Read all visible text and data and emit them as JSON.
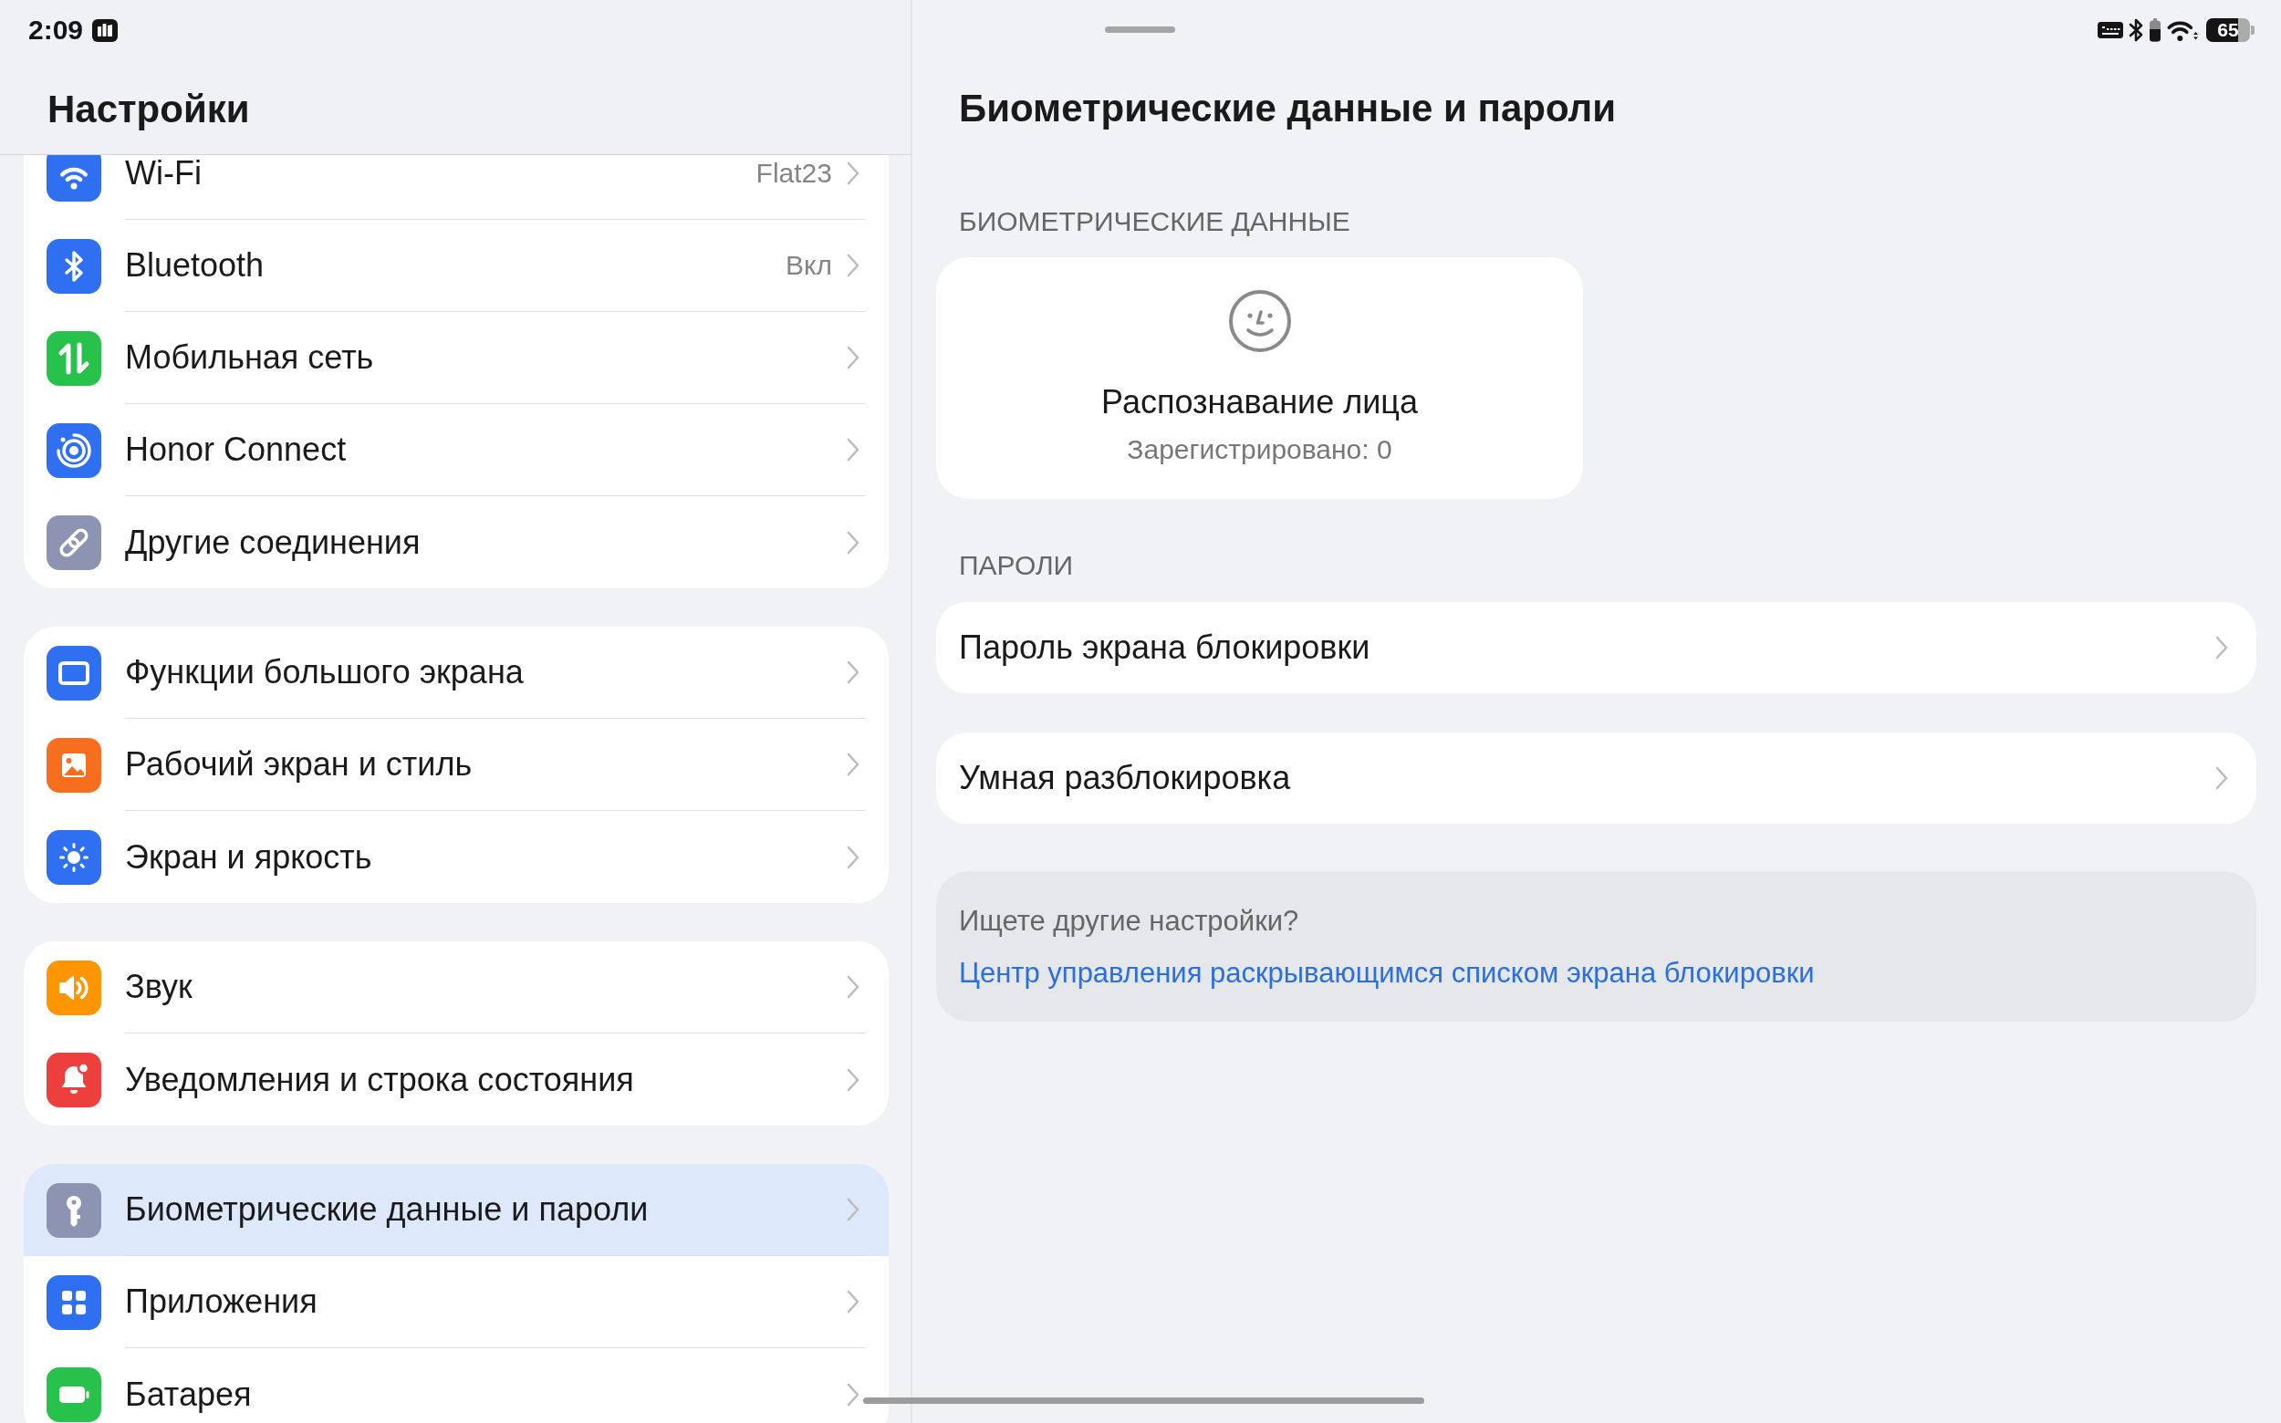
{
  "status_bar": {
    "time": "2:09",
    "battery": "65"
  },
  "sidebar": {
    "title": "Настройки",
    "groups": [
      {
        "items": [
          {
            "label": "Wi-Fi",
            "value": "Flat23",
            "selected": false
          },
          {
            "label": "Bluetooth",
            "value": "Вкл",
            "selected": false
          },
          {
            "label": "Мобильная сеть",
            "selected": false
          },
          {
            "label": "Honor Connect",
            "selected": false
          },
          {
            "label": "Другие соединения",
            "selected": false
          }
        ]
      },
      {
        "items": [
          {
            "label": "Функции большого экрана",
            "selected": false
          },
          {
            "label": "Рабочий экран и стиль",
            "selected": false
          },
          {
            "label": "Экран и яркость",
            "selected": false
          }
        ]
      },
      {
        "items": [
          {
            "label": "Звук",
            "selected": false
          },
          {
            "label": "Уведомления и строка состояния",
            "selected": false
          }
        ]
      },
      {
        "items": [
          {
            "label": "Биометрические данные и пароли",
            "selected": true
          },
          {
            "label": "Приложения",
            "selected": false
          },
          {
            "label": "Батарея",
            "selected": false
          }
        ]
      }
    ]
  },
  "detail": {
    "title": "Биометрические данные и пароли",
    "biometrics": {
      "heading": "БИОМЕТРИЧЕСКИЕ ДАННЫЕ",
      "face_card": {
        "title": "Распознавание лица",
        "subtitle": "Зарегистрировано: 0"
      }
    },
    "passwords": {
      "heading": "ПАРОЛИ",
      "items": [
        {
          "label": "Пароль экрана блокировки"
        },
        {
          "label": "Умная разблокировка"
        }
      ]
    },
    "suggestion": {
      "question": "Ищете другие настройки?",
      "link": "Центр управления раскрывающимся списком экрана блокировки"
    }
  }
}
